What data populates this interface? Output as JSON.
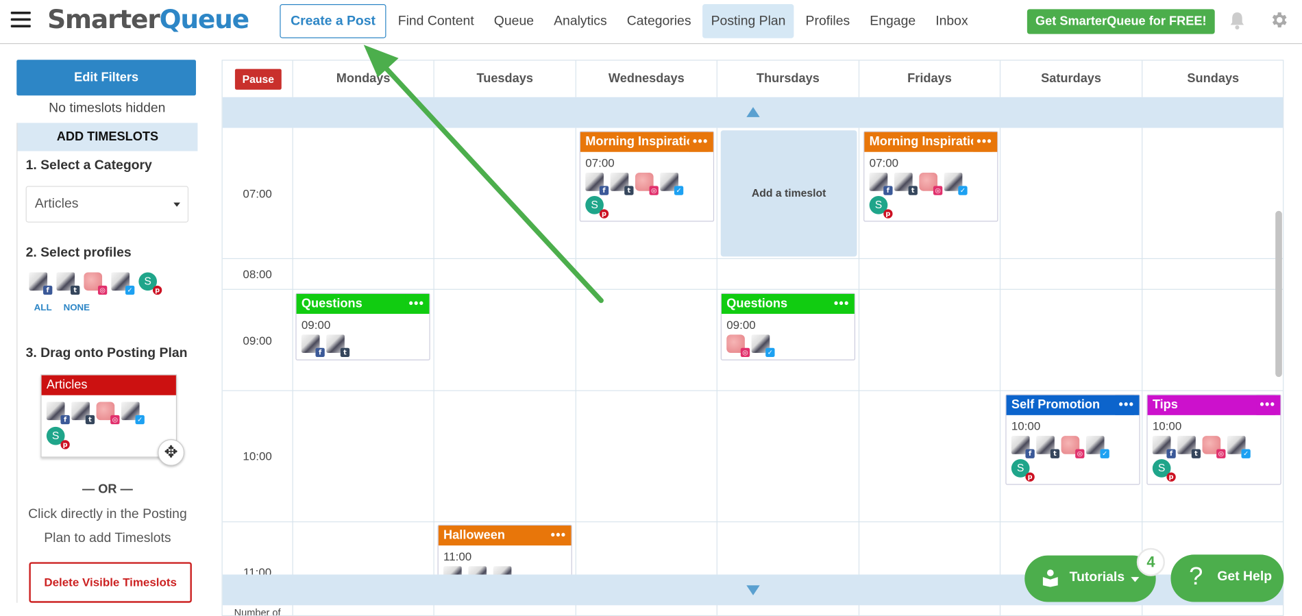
{
  "header": {
    "logo_part1": "Smarter",
    "logo_part2": "Queue",
    "nav": [
      "Create a Post",
      "Find Content",
      "Queue",
      "Analytics",
      "Categories",
      "Posting Plan",
      "Profiles",
      "Engage",
      "Inbox"
    ],
    "active_nav": "Posting Plan",
    "cta": "Get SmarterQueue for FREE!"
  },
  "sidebar": {
    "edit_filters": "Edit Filters",
    "hidden_note": "No timeslots hidden",
    "add_title": "ADD TIMESLOTS",
    "step1": "1. Select a Category",
    "category_value": "Articles",
    "step2": "2. Select profiles",
    "all": "ALL",
    "none": "NONE",
    "step3": "3. Drag onto Posting Plan",
    "drag_card_title": "Articles",
    "or": "— OR —",
    "click_note_1": "Click directly in the Posting",
    "click_note_2": "Plan to add Timeslots",
    "delete_btn": "Delete Visible Timeslots"
  },
  "grid": {
    "pause": "Pause",
    "days": [
      "Mondays",
      "Tuesdays",
      "Wednesdays",
      "Thursdays",
      "Fridays",
      "Saturdays",
      "Sundays"
    ],
    "times": [
      "07:00",
      "08:00",
      "09:00",
      "10:00",
      "11:00"
    ],
    "add_timeslot": "Add a timeslot",
    "footer_label": "Number of",
    "slots": {
      "wed_0700": {
        "title": "Morning Inspiration",
        "time": "07:00",
        "color": "#e8760a"
      },
      "fri_0700": {
        "title": "Morning Inspiration",
        "time": "07:00",
        "color": "#e8760a"
      },
      "mon_0900": {
        "title": "Questions",
        "time": "09:00",
        "color": "#11cc11"
      },
      "thu_0900": {
        "title": "Questions",
        "time": "09:00",
        "color": "#11cc11"
      },
      "sat_1000": {
        "title": "Self Promotion",
        "time": "10:00",
        "color": "#0c64cc"
      },
      "sun_1000": {
        "title": "Tips",
        "time": "10:00",
        "color": "#cc11cc"
      },
      "tue_1100": {
        "title": "Halloween",
        "time": "11:00",
        "color": "#e8760a"
      }
    },
    "dots": "•••"
  },
  "widgets": {
    "tutorials": "Tutorials",
    "tutorials_count": "4",
    "get_help": "Get Help"
  },
  "icons": {
    "profile_badges": [
      "facebook",
      "tumblr",
      "instagram",
      "twitter",
      "pinterest"
    ],
    "profile_avatar_letter": "S"
  }
}
